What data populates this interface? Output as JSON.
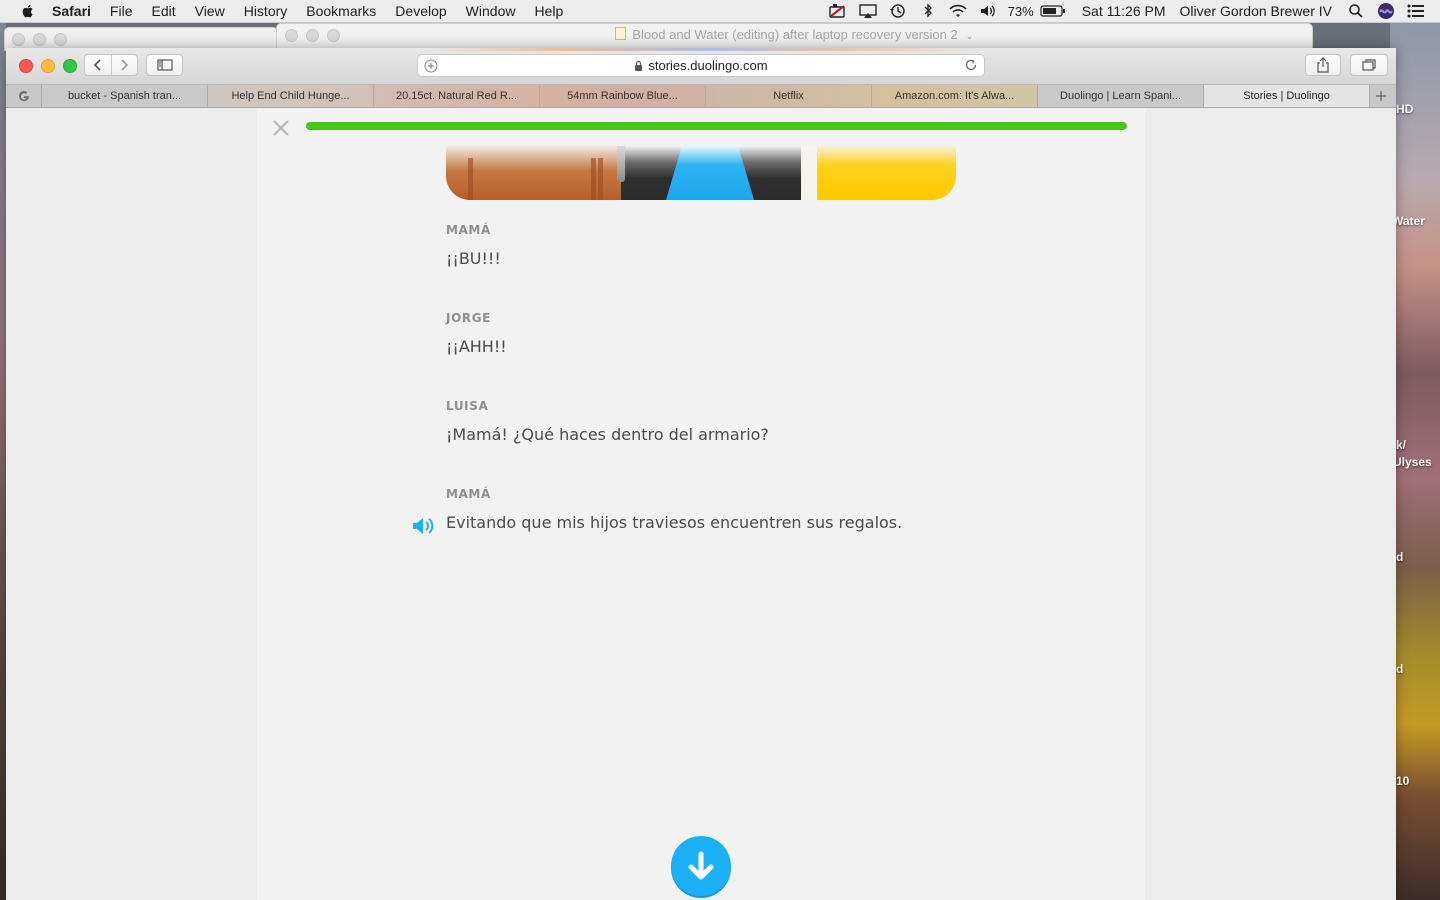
{
  "menubar": {
    "items": [
      "Safari",
      "File",
      "Edit",
      "View",
      "History",
      "Bookmarks",
      "Develop",
      "Window",
      "Help"
    ],
    "battery": "73%",
    "clock": "Sat 11:26 PM",
    "user": "Oliver Gordon Brewer IV"
  },
  "background_window": {
    "title": "Blood and Water (editing) after laptop recovery version 2"
  },
  "safari": {
    "url": "stories.duolingo.com",
    "tabs": [
      "bucket - Spanish tran...",
      "Help End Child Hunge...",
      "20.15ct. Natural Red R...",
      "54mm Rainbow Blue...",
      "Netflix",
      "Amazon.com: It's Alwa...",
      "Duolingo | Learn Spani...",
      "Stories | Duolingo"
    ],
    "active_tab_index": 7
  },
  "story": {
    "progress": 1.0,
    "lines": [
      {
        "speaker": "MAMÁ",
        "text": "¡¡BU!!!"
      },
      {
        "speaker": "JORGE",
        "text": "¡¡AHH!!"
      },
      {
        "speaker": "LUISA",
        "text": "¡Mamá! ¿Qué haces dentro del armario?"
      },
      {
        "speaker": "MAMÁ",
        "text": "Evitando que mis hijos traviesos encuentren sus regalos."
      }
    ]
  },
  "desktop": {
    "labels": [
      "HD",
      "Water",
      "k/",
      "Ulyses",
      "d",
      "d",
      "10"
    ]
  },
  "colors": {
    "progress_green": "#46c51a",
    "continue_blue": "#1cb0f6"
  }
}
